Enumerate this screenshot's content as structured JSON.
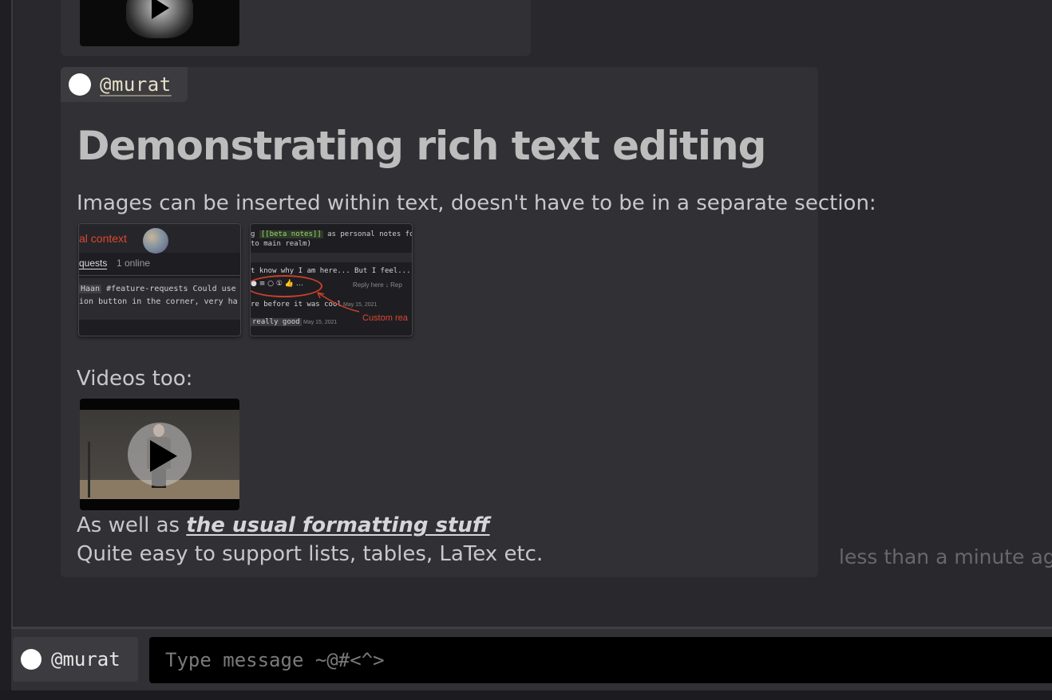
{
  "message": {
    "author": "@murat",
    "heading": "Demonstrating rich text editing",
    "images_line": "Images can be inserted within text, doesn't have to be in a separate section:",
    "videos_line": "Videos too:",
    "formatting_prefix": "As well as ",
    "formatting_emphasis": "the usual formatting stuff",
    "latex_line": "Quite easy to support lists, tables, LaTex etc.",
    "timestamp": "less than a minute ago",
    "inline_images": [
      {
        "title": "al context",
        "tab": "quests",
        "online": "1 online",
        "user": "Haan",
        "channel": "#feature-requests",
        "row1_text": "Could use",
        "row2_text": "ion button in the corner, very ha"
      },
      {
        "head1_pre": "g",
        "head1_tag": "[[beta notes]]",
        "head1_post": "as personal notes for c",
        "head2": "to main realm)",
        "row1": "t know why I am here... But I feel.... S",
        "reactions": "● ≡ ○ ① 👍 …",
        "reply": "Reply here ↓    Rep",
        "row2": "re before it was cool",
        "row3": "really good",
        "date": "May 15, 2021",
        "callout": "Custom rea"
      }
    ]
  },
  "composer": {
    "author": "@murat",
    "placeholder": "Type message ~@#<^>"
  }
}
